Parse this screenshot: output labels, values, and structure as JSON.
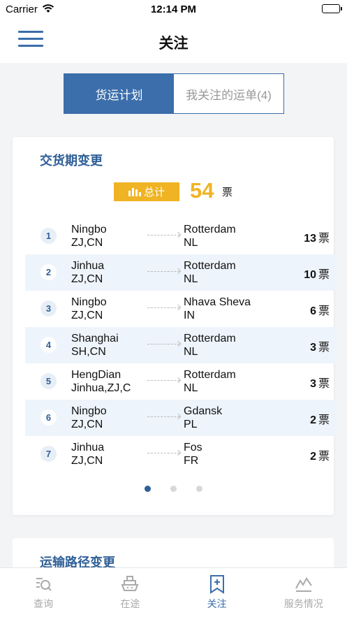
{
  "status_bar": {
    "carrier": "Carrier",
    "time": "12:14 PM"
  },
  "nav": {
    "title": "关注",
    "menu_icon": "hamburger-menu-icon"
  },
  "segments": [
    {
      "label": "货运计划",
      "active": true
    },
    {
      "label": "我关注的运单(4)",
      "active": false
    }
  ],
  "section1": {
    "title": "交货期变更",
    "total_label": "总计",
    "total_value": "54",
    "total_unit": "票",
    "rows": [
      {
        "index": "1",
        "from_city": "Ningbo",
        "from_region": "ZJ,CN",
        "to_city": "Rotterdam",
        "to_region": "NL",
        "count": "13",
        "unit": "票"
      },
      {
        "index": "2",
        "from_city": "Jinhua",
        "from_region": "ZJ,CN",
        "to_city": "Rotterdam",
        "to_region": "NL",
        "count": "10",
        "unit": "票"
      },
      {
        "index": "3",
        "from_city": "Ningbo",
        "from_region": "ZJ,CN",
        "to_city": "Nhava Sheva",
        "to_region": "IN",
        "count": "6",
        "unit": "票"
      },
      {
        "index": "4",
        "from_city": "Shanghai",
        "from_region": "SH,CN",
        "to_city": "Rotterdam",
        "to_region": "NL",
        "count": "3",
        "unit": "票"
      },
      {
        "index": "5",
        "from_city": "HengDian",
        "from_region": "Jinhua,ZJ,C",
        "to_city": "Rotterdam",
        "to_region": "NL",
        "count": "3",
        "unit": "票"
      },
      {
        "index": "6",
        "from_city": "Ningbo",
        "from_region": "ZJ,CN",
        "to_city": "Gdansk",
        "to_region": "PL",
        "count": "2",
        "unit": "票"
      },
      {
        "index": "7",
        "from_city": "Jinhua",
        "from_region": "ZJ,CN",
        "to_city": "Fos",
        "to_region": "FR",
        "count": "2",
        "unit": "票"
      }
    ],
    "page_dots": 3,
    "active_dot": 1
  },
  "section2": {
    "title": "运输路径变更"
  },
  "tabbar": [
    {
      "label": "查询",
      "icon": "search-list-icon",
      "active": false
    },
    {
      "label": "在途",
      "icon": "ship-icon",
      "active": false
    },
    {
      "label": "关注",
      "icon": "bookmark-plus-icon",
      "active": true
    },
    {
      "label": "服务情况",
      "icon": "service-chart-icon",
      "active": false
    }
  ],
  "colors": {
    "primary": "#3b6eaa",
    "accent": "#f0b323",
    "title_blue": "#2f5f97"
  }
}
